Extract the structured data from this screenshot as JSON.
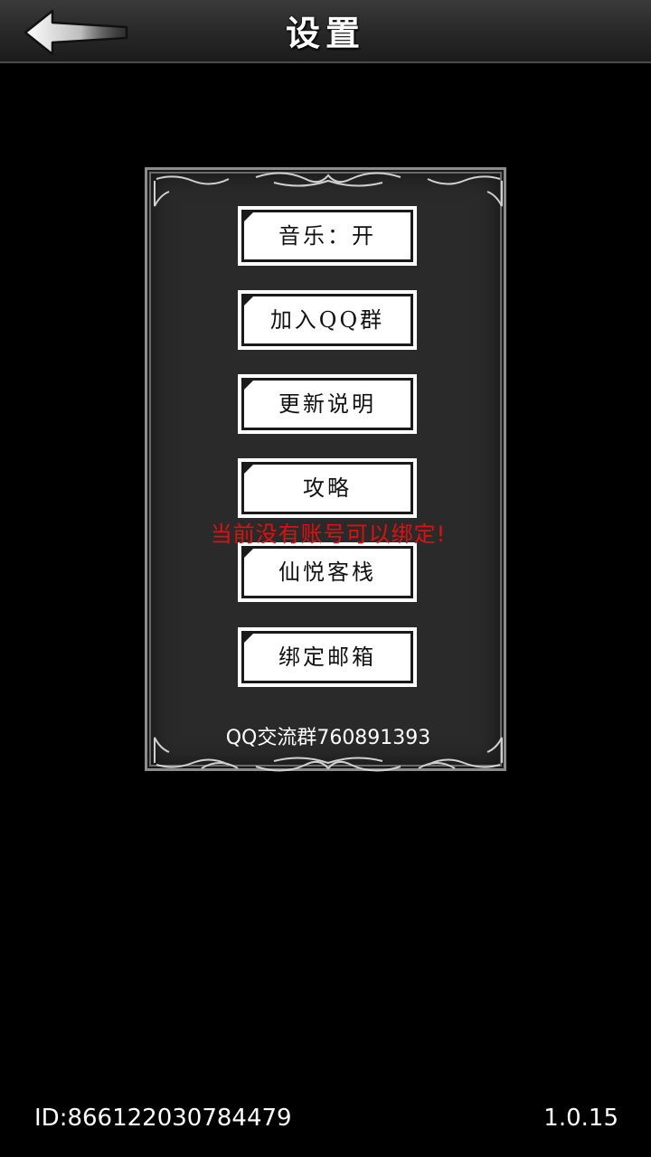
{
  "header": {
    "title": "设置",
    "back_icon": "arrow-left-icon"
  },
  "menu": {
    "items": [
      {
        "label": "音乐：开"
      },
      {
        "label": "加入QQ群"
      },
      {
        "label": "更新说明"
      },
      {
        "label": "攻略"
      },
      {
        "label": "仙悦客栈"
      },
      {
        "label": "绑定邮箱"
      }
    ]
  },
  "warning": {
    "text": "当前没有账号可以绑定!",
    "color": "#e01010"
  },
  "qq_group": {
    "text": "QQ交流群760891393"
  },
  "footer": {
    "id": "ID:866122030784479",
    "version": "1.0.15"
  }
}
